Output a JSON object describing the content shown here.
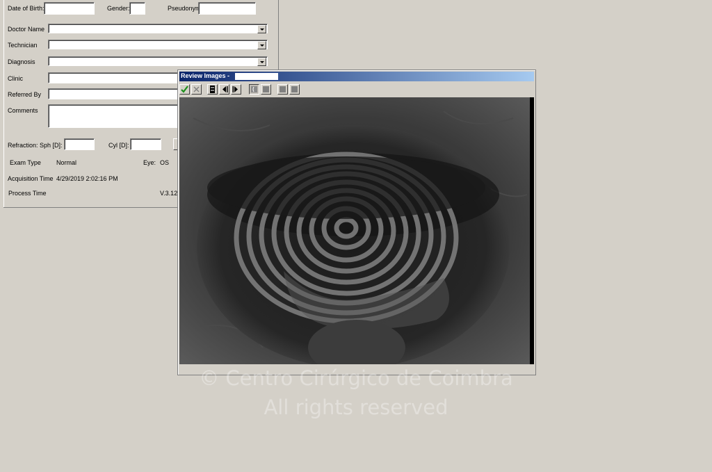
{
  "patient_form": {
    "date_of_birth_label": "Date of Birth:",
    "date_of_birth_value": "",
    "gender_label": "Gender:",
    "gender_value": "",
    "pseudonym_label": "Pseudonym",
    "pseudonym_value": "",
    "doctor_name_label": "Doctor Name",
    "doctor_name_value": "",
    "technician_label": "Technician",
    "technician_value": "",
    "diagnosis_label": "Diagnosis",
    "diagnosis_value": "",
    "clinic_label": "Clinic",
    "clinic_value": "",
    "referred_by_label": "Referred By",
    "referred_by_value": "",
    "comments_label": "Comments",
    "comments_value": "",
    "refraction_sph_label": "Refraction: Sph [D]:",
    "refraction_sph_value": "",
    "cyl_label": "Cyl [D]:",
    "cyl_value": "",
    "exam_type_label": "Exam Type",
    "exam_type_value": "Normal",
    "eye_label": "Eye:",
    "eye_value": "OS",
    "acquisition_time_label": "Acquisition Time",
    "acquisition_time_value": "4/29/2019 2:02:16 PM",
    "process_time_label": "Process Time",
    "version_value": "V.3.12"
  },
  "review_dialog": {
    "title": "Review Images -",
    "title_field_value": "",
    "toolbar_icons": [
      "checkmark-icon",
      "x-icon",
      "film-icon",
      "previous-icon",
      "next-icon",
      "mode-icon",
      "mode-icon",
      "mode-icon",
      "mode-icon"
    ]
  },
  "watermark": {
    "line1": "© Centro Cirúrgico de Coimbra",
    "line2": "All rights reserved"
  },
  "colors": {
    "desktop": "#d4d0c8",
    "titlebar_start": "#0a246a",
    "titlebar_end": "#a6caf0",
    "check_green": "#1a8f1a"
  }
}
